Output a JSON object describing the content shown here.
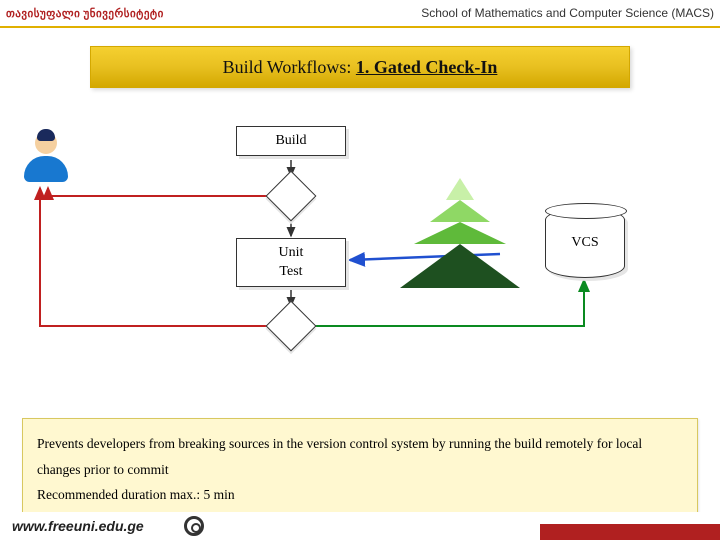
{
  "header": {
    "left": "თავისუფალი უნივერსიტეტი",
    "right": "School of Mathematics and Computer Science (MACS)"
  },
  "title": {
    "prefix": "Build Workflows: ",
    "main": "1. Gated Check-In"
  },
  "boxes": {
    "build": "Build",
    "unit_l1": "Unit",
    "unit_l2": "Test",
    "vcs": "VCS"
  },
  "description": {
    "line1": "Prevents developers from breaking sources in the version control system by running the build remotely for local changes prior to commit",
    "line2": "Recommended duration max.: 5 min"
  },
  "footer": {
    "url": "www.freeuni.edu.ge"
  }
}
